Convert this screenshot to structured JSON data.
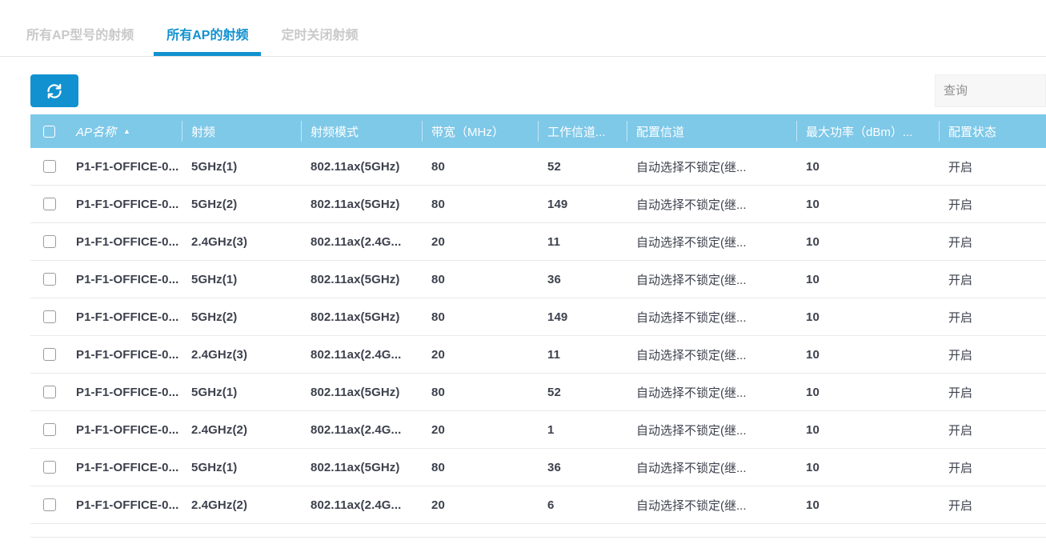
{
  "tabs": [
    {
      "label": "所有AP型号的射频",
      "active": false
    },
    {
      "label": "所有AP的射频",
      "active": true
    },
    {
      "label": "定时关闭射频",
      "active": false
    }
  ],
  "toolbar": {
    "refresh_icon": "refresh-icon",
    "search_placeholder": "查询"
  },
  "table": {
    "columns": [
      "AP名称",
      "射频",
      "射频模式",
      "带宽（MHz）",
      "工作信道...",
      "配置信道",
      "最大功率（dBm）...",
      "配置状态"
    ],
    "sort_column": "AP名称",
    "sort_direction": "asc",
    "sort_indicator": "▲",
    "rows": [
      {
        "ap_name": "P1-F1-OFFICE-0...",
        "radio": "5GHz(1)",
        "radio_mode": "802.11ax(5GHz)",
        "bandwidth": "80",
        "working_channel": "52",
        "config_channel": "自动选择不锁定(继...",
        "max_power": "10",
        "config_status": "开启"
      },
      {
        "ap_name": "P1-F1-OFFICE-0...",
        "radio": "5GHz(2)",
        "radio_mode": "802.11ax(5GHz)",
        "bandwidth": "80",
        "working_channel": "149",
        "config_channel": "自动选择不锁定(继...",
        "max_power": "10",
        "config_status": "开启"
      },
      {
        "ap_name": "P1-F1-OFFICE-0...",
        "radio": "2.4GHz(3)",
        "radio_mode": "802.11ax(2.4G...",
        "bandwidth": "20",
        "working_channel": "11",
        "config_channel": "自动选择不锁定(继...",
        "max_power": "10",
        "config_status": "开启"
      },
      {
        "ap_name": "P1-F1-OFFICE-0...",
        "radio": "5GHz(1)",
        "radio_mode": "802.11ax(5GHz)",
        "bandwidth": "80",
        "working_channel": "36",
        "config_channel": "自动选择不锁定(继...",
        "max_power": "10",
        "config_status": "开启"
      },
      {
        "ap_name": "P1-F1-OFFICE-0...",
        "radio": "5GHz(2)",
        "radio_mode": "802.11ax(5GHz)",
        "bandwidth": "80",
        "working_channel": "149",
        "config_channel": "自动选择不锁定(继...",
        "max_power": "10",
        "config_status": "开启"
      },
      {
        "ap_name": "P1-F1-OFFICE-0...",
        "radio": "2.4GHz(3)",
        "radio_mode": "802.11ax(2.4G...",
        "bandwidth": "20",
        "working_channel": "11",
        "config_channel": "自动选择不锁定(继...",
        "max_power": "10",
        "config_status": "开启"
      },
      {
        "ap_name": "P1-F1-OFFICE-0...",
        "radio": "5GHz(1)",
        "radio_mode": "802.11ax(5GHz)",
        "bandwidth": "80",
        "working_channel": "52",
        "config_channel": "自动选择不锁定(继...",
        "max_power": "10",
        "config_status": "开启"
      },
      {
        "ap_name": "P1-F1-OFFICE-0...",
        "radio": "2.4GHz(2)",
        "radio_mode": "802.11ax(2.4G...",
        "bandwidth": "20",
        "working_channel": "1",
        "config_channel": "自动选择不锁定(继...",
        "max_power": "10",
        "config_status": "开启"
      },
      {
        "ap_name": "P1-F1-OFFICE-0...",
        "radio": "5GHz(1)",
        "radio_mode": "802.11ax(5GHz)",
        "bandwidth": "80",
        "working_channel": "36",
        "config_channel": "自动选择不锁定(继...",
        "max_power": "10",
        "config_status": "开启"
      },
      {
        "ap_name": "P1-F1-OFFICE-0...",
        "radio": "2.4GHz(2)",
        "radio_mode": "802.11ax(2.4G...",
        "bandwidth": "20",
        "working_channel": "6",
        "config_channel": "自动选择不锁定(继...",
        "max_power": "10",
        "config_status": "开启"
      }
    ]
  },
  "colors": {
    "accent_blue": "#1191d0",
    "table_header_blue": "#7ec8e8",
    "inactive_tab_gray": "#c9c9c9",
    "cell_text": "#3d414d",
    "row_border": "#e9e9e9"
  }
}
